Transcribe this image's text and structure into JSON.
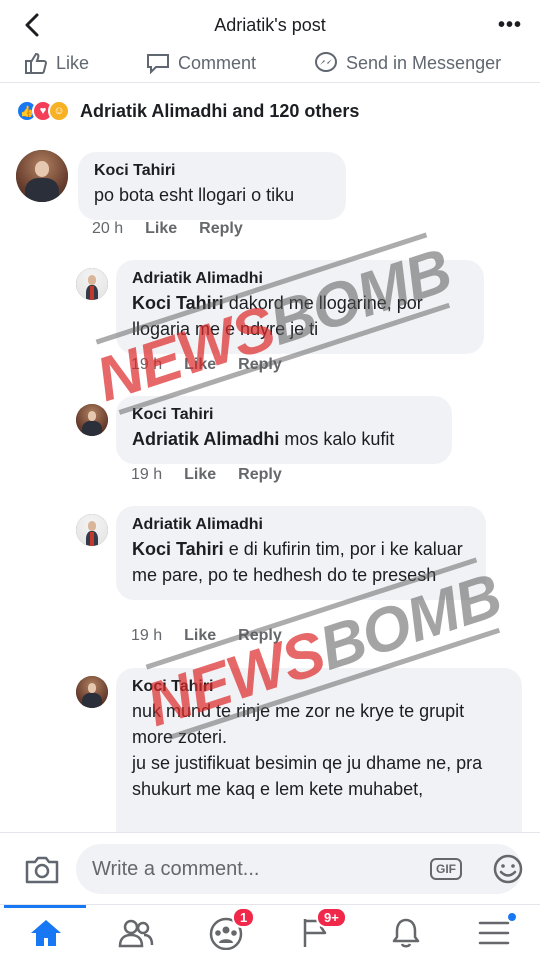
{
  "header": {
    "title": "Adriatik's post",
    "more": "•••"
  },
  "actions": {
    "like": "Like",
    "comment": "Comment",
    "send": "Send in Messenger"
  },
  "reactions": {
    "summary": "Adriatik Alimadhi and 120 others"
  },
  "comments": [
    {
      "author": "Koci Tahiri",
      "text": "po bota esht llogari o tiku",
      "time": "20 h",
      "like": "Like",
      "reply": "Reply"
    },
    {
      "author": "Adriatik Alimadhi",
      "tag": "Koci Tahiri",
      "text": " dakord me llogarine, por llogaria me e ndyre je ti",
      "time": "19 h",
      "like": "Like",
      "reply": "Reply"
    },
    {
      "author": "Koci Tahiri",
      "tag": "Adriatik Alimadhi",
      "text": " mos kalo kufit",
      "time": "19 h",
      "like": "Like",
      "reply": "Reply"
    },
    {
      "author": "Adriatik Alimadhi",
      "tag": "Koci Tahiri",
      "text": " e di kufirin tim, por i ke kaluar me pare, po te hedhesh do te presesh",
      "time": "19 h",
      "like": "Like",
      "reply": "Reply"
    },
    {
      "author": "Koci Tahiri",
      "line1": "nuk mund te rinje  me zor ne krye te grupit more zoteri.",
      "line2": "ju se justifikuat besimin qe ju dhame ne, pra shukurt me kaq e lem kete muhabet,"
    }
  ],
  "composer": {
    "placeholder": "Write a comment...",
    "gif": "GIF"
  },
  "tabbar": {
    "groups_badge": "1",
    "pages_badge": "9+"
  },
  "watermark": {
    "part_a": "NEWS",
    "part_b": "BOMB"
  },
  "colors": {
    "accent": "#1877f2",
    "bubble": "#f0f2f5",
    "badge": "#f02849"
  }
}
